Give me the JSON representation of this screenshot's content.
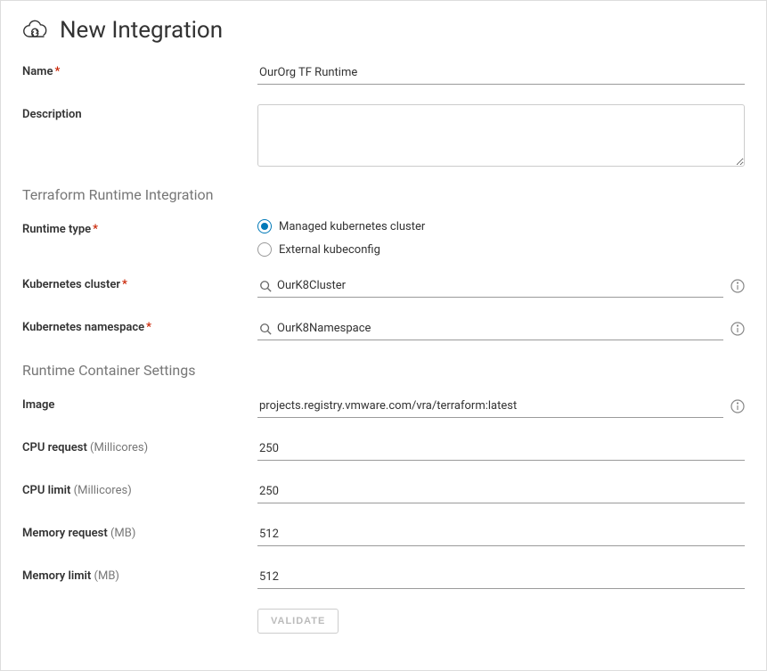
{
  "header": {
    "title": "New Integration"
  },
  "form": {
    "name": {
      "label": "Name",
      "value": "OurOrg TF Runtime"
    },
    "description": {
      "label": "Description",
      "value": ""
    }
  },
  "section_runtime": {
    "title": "Terraform Runtime Integration",
    "runtime_type": {
      "label": "Runtime type",
      "options": [
        {
          "label": "Managed kubernetes cluster",
          "checked": true
        },
        {
          "label": "External kubeconfig",
          "checked": false
        }
      ]
    },
    "k8s_cluster": {
      "label": "Kubernetes cluster",
      "value": "OurK8Cluster"
    },
    "k8s_namespace": {
      "label": "Kubernetes namespace",
      "value": "OurK8Namespace"
    }
  },
  "section_container": {
    "title": "Runtime Container Settings",
    "image": {
      "label": "Image",
      "value": "projects.registry.vmware.com/vra/terraform:latest"
    },
    "cpu_request": {
      "label": "CPU request",
      "unit": "(Millicores)",
      "value": "250"
    },
    "cpu_limit": {
      "label": "CPU limit",
      "unit": "(Millicores)",
      "value": "250"
    },
    "memory_request": {
      "label": "Memory request",
      "unit": "(MB)",
      "value": "512"
    },
    "memory_limit": {
      "label": "Memory limit",
      "unit": "(MB)",
      "value": "512"
    }
  },
  "actions": {
    "validate": "Validate"
  }
}
